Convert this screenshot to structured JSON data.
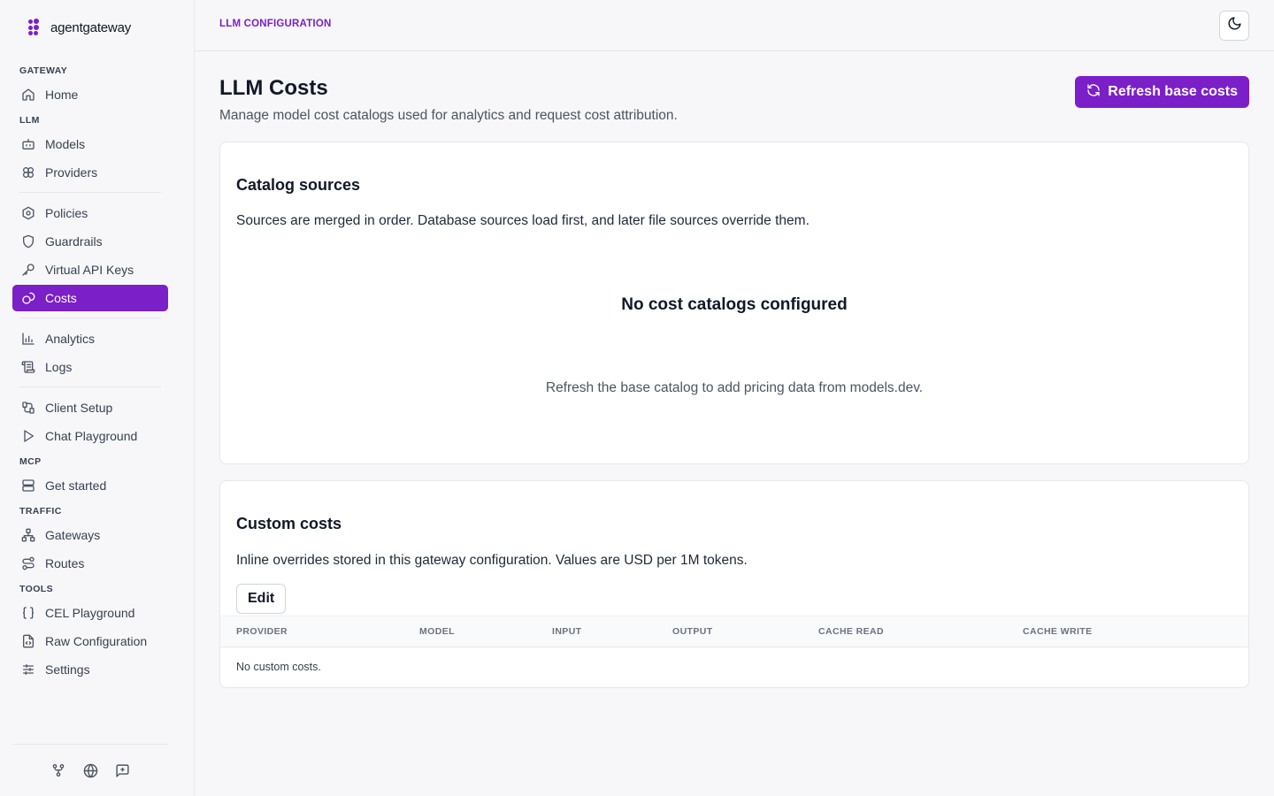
{
  "brand": {
    "name": "agentgateway",
    "color": "#7b1fc9"
  },
  "sidebar": {
    "sections": [
      {
        "label": "GATEWAY",
        "items": [
          {
            "label": "Home",
            "icon": "home-icon"
          }
        ]
      },
      {
        "label": "LLM",
        "items": [
          {
            "label": "Models",
            "icon": "bot-icon"
          },
          {
            "label": "Providers",
            "icon": "providers-icon"
          },
          {
            "label": "Policies",
            "icon": "policies-icon"
          },
          {
            "label": "Guardrails",
            "icon": "shield-icon"
          },
          {
            "label": "Virtual API Keys",
            "icon": "key-icon"
          },
          {
            "label": "Costs",
            "icon": "coins-icon",
            "active": true
          },
          {
            "label": "Analytics",
            "icon": "bar-chart-icon"
          },
          {
            "label": "Logs",
            "icon": "scroll-icon"
          },
          {
            "label": "Client Setup",
            "icon": "plug-icon"
          },
          {
            "label": "Chat Playground",
            "icon": "play-icon"
          }
        ]
      },
      {
        "label": "MCP",
        "items": [
          {
            "label": "Get started",
            "icon": "server-icon"
          }
        ]
      },
      {
        "label": "TRAFFIC",
        "items": [
          {
            "label": "Gateways",
            "icon": "network-icon"
          },
          {
            "label": "Routes",
            "icon": "route-icon"
          }
        ]
      },
      {
        "label": "TOOLS",
        "items": [
          {
            "label": "CEL Playground",
            "icon": "braces-icon"
          },
          {
            "label": "Raw Configuration",
            "icon": "file-code-icon"
          },
          {
            "label": "Settings",
            "icon": "sliders-icon"
          }
        ]
      }
    ],
    "footer_icons": [
      "git-fork-icon",
      "globe-icon",
      "feedback-icon"
    ]
  },
  "header": {
    "breadcrumb": "LLM CONFIGURATION",
    "theme_icon": "moon-icon"
  },
  "page": {
    "title": "LLM Costs",
    "subtitle": "Manage model cost catalogs used for analytics and request cost attribution.",
    "refresh_button": "Refresh base costs"
  },
  "catalog": {
    "title": "Catalog sources",
    "description": "Sources are merged in order. Database sources load first, and later file sources override them.",
    "empty_title": "No cost catalogs configured",
    "empty_description": "Refresh the base catalog to add pricing data from models.dev."
  },
  "custom": {
    "title": "Custom costs",
    "description": "Inline overrides stored in this gateway configuration. Values are USD per 1M tokens.",
    "edit_button": "Edit",
    "columns": [
      "PROVIDER",
      "MODEL",
      "INPUT",
      "OUTPUT",
      "CACHE READ",
      "CACHE WRITE"
    ],
    "empty_text": "No custom costs."
  }
}
